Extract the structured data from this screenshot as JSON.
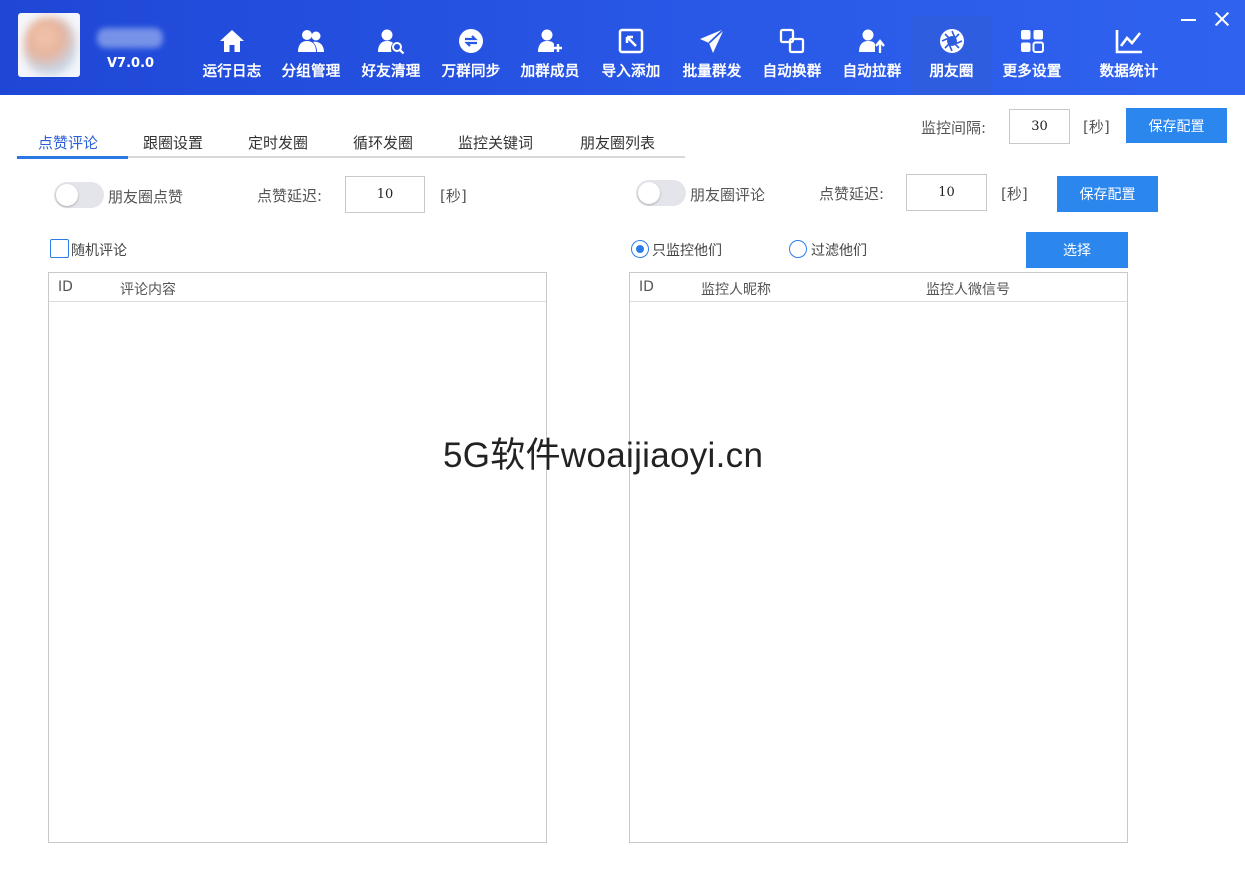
{
  "app": {
    "version": "V7.0.0"
  },
  "nav": [
    {
      "label": "运行日志",
      "icon": "home-icon"
    },
    {
      "label": "分组管理",
      "icon": "group-icon"
    },
    {
      "label": "好友清理",
      "icon": "user-search-icon"
    },
    {
      "label": "万群同步",
      "icon": "sync-icon"
    },
    {
      "label": "加群成员",
      "icon": "add-user-icon"
    },
    {
      "label": "导入添加",
      "icon": "import-icon"
    },
    {
      "label": "批量群发",
      "icon": "send-icon"
    },
    {
      "label": "自动换群",
      "icon": "switch-icon"
    },
    {
      "label": "自动拉群",
      "icon": "pull-user-icon"
    },
    {
      "label": "朋友圈",
      "icon": "moments-icon"
    },
    {
      "label": "更多设置",
      "icon": "grid-icon"
    },
    {
      "label": "数据统计",
      "icon": "chart-icon"
    }
  ],
  "active_nav": "朋友圈",
  "subtabs": [
    "点赞评论",
    "跟圈设置",
    "定时发圈",
    "循环发圈",
    "监控关键词",
    "朋友圈列表"
  ],
  "monitor": {
    "interval_label": "监控间隔:",
    "interval_value": "30",
    "unit": "[秒]",
    "save_label": "保存配置"
  },
  "left_panel": {
    "toggle_label": "朋友圈点赞",
    "delay_label": "点赞延迟:",
    "delay_value": "10",
    "unit": "[秒]",
    "random_comment_label": "随机评论",
    "table_columns": [
      "ID",
      "评论内容"
    ]
  },
  "right_panel": {
    "toggle_label": "朋友圈评论",
    "delay_label": "点赞延迟:",
    "delay_value": "10",
    "unit": "[秒]",
    "save_label": "保存配置",
    "radio_only_label": "只监控他们",
    "radio_filter_label": "过滤他们",
    "select_label": "选择",
    "table_columns": [
      "ID",
      "监控人昵称",
      "监控人微信号"
    ]
  },
  "watermark": "5G软件woaijiaoyi.cn",
  "colors": {
    "header": "#2957e6",
    "accent": "#2b86ee",
    "active_tab": "#2a5fd8"
  }
}
